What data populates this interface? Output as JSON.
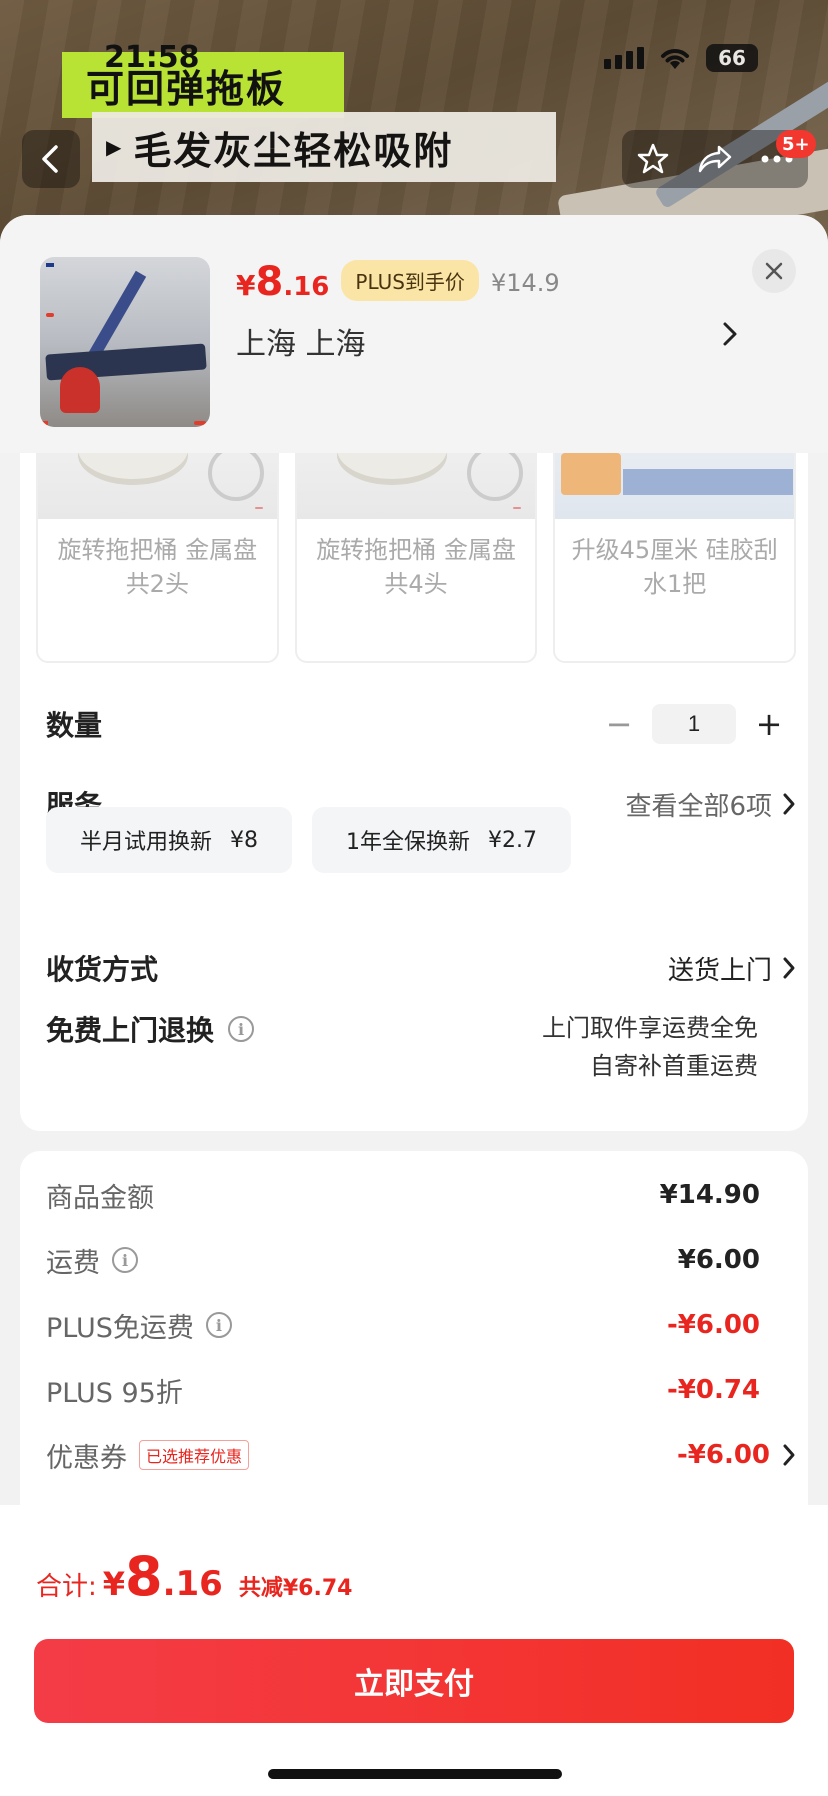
{
  "status_bar": {
    "time": "21:58",
    "battery": "66"
  },
  "banner": {
    "promo_line1": "可回弹拖板",
    "promo_line2": "毛发灰尘轻松吸附",
    "cart_badge": "5+"
  },
  "sku": {
    "price_currency": "¥",
    "price_int": "8",
    "price_dec": ".16",
    "plus_badge": "PLUS到手价",
    "original_price": "¥14.9",
    "address": "上海  上海"
  },
  "options": [
    {
      "label": "旋转拖把桶 金属盘共2头"
    },
    {
      "label": "旋转拖把桶 金属盘共4头"
    },
    {
      "label": "升级45厘米 硅胶刮水1把"
    }
  ],
  "quantity": {
    "label": "数量",
    "value": "1",
    "minus": "−",
    "plus": "+"
  },
  "service": {
    "label": "服务",
    "view_all": "查看全部6项",
    "chips": [
      {
        "name": "半月试用换新",
        "price": "¥8"
      },
      {
        "name": "1年全保换新",
        "price": "¥2.7"
      }
    ]
  },
  "delivery": {
    "label": "收货方式",
    "value": "送货上门"
  },
  "return_service": {
    "label": "免费上门退换",
    "line1": "上门取件享运费全免",
    "line2": "自寄补首重运费"
  },
  "price_breakdown": [
    {
      "label": "商品金额",
      "value": "¥14.90",
      "red": false,
      "info": false
    },
    {
      "label": "运费",
      "value": "¥6.00",
      "red": false,
      "info": true
    },
    {
      "label": "PLUS免运费",
      "value": "-¥6.00",
      "red": true,
      "info": true
    },
    {
      "label": "PLUS 95折",
      "value": "-¥0.74",
      "red": true,
      "info": false
    },
    {
      "label": "优惠券",
      "value": "-¥6.00",
      "red": true,
      "info": false,
      "tag": "已选推荐优惠"
    }
  ],
  "total": {
    "label": "合计:",
    "currency": "¥",
    "int": "8",
    "dec": ".16",
    "saving": "共减¥6.74"
  },
  "pay_button": "立即支付",
  "colors": {
    "accent_red": "#e8261f",
    "plus_gold": "#fbe5a6"
  }
}
